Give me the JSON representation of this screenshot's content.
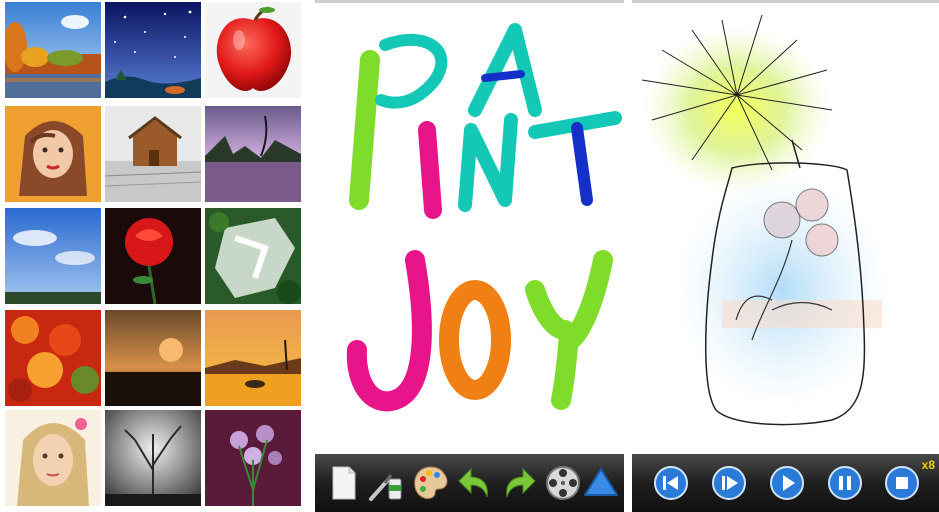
{
  "gallery": {
    "items": [
      {
        "name": "autumn-lake-painting"
      },
      {
        "name": "night-sky-painting"
      },
      {
        "name": "red-apple-painting"
      },
      {
        "name": "woman-portrait-painting"
      },
      {
        "name": "barn-in-snow-painting"
      },
      {
        "name": "purple-lake-painting"
      },
      {
        "name": "blue-sky-painting"
      },
      {
        "name": "red-rose-painting"
      },
      {
        "name": "waterfall-painting"
      },
      {
        "name": "red-foliage-painting"
      },
      {
        "name": "sunset-dusk-painting"
      },
      {
        "name": "orange-sunset-painting"
      },
      {
        "name": "girl-portrait-painting"
      },
      {
        "name": "bare-tree-painting"
      },
      {
        "name": "purple-flowers-painting"
      }
    ]
  },
  "title_art": {
    "line1": "PA",
    "line2": "INT",
    "line3": "JOY"
  },
  "toolbar": {
    "tools": [
      {
        "name": "new-page-icon"
      },
      {
        "name": "brush-icon"
      },
      {
        "name": "palette-icon"
      },
      {
        "name": "undo-icon"
      },
      {
        "name": "redo-icon"
      },
      {
        "name": "film-reel-icon"
      },
      {
        "name": "triangle-icon"
      }
    ]
  },
  "playback": {
    "speed": "x8",
    "buttons": [
      {
        "name": "rewind-icon"
      },
      {
        "name": "step-forward-icon"
      },
      {
        "name": "play-icon"
      },
      {
        "name": "pause-icon"
      },
      {
        "name": "stop-icon"
      }
    ]
  }
}
